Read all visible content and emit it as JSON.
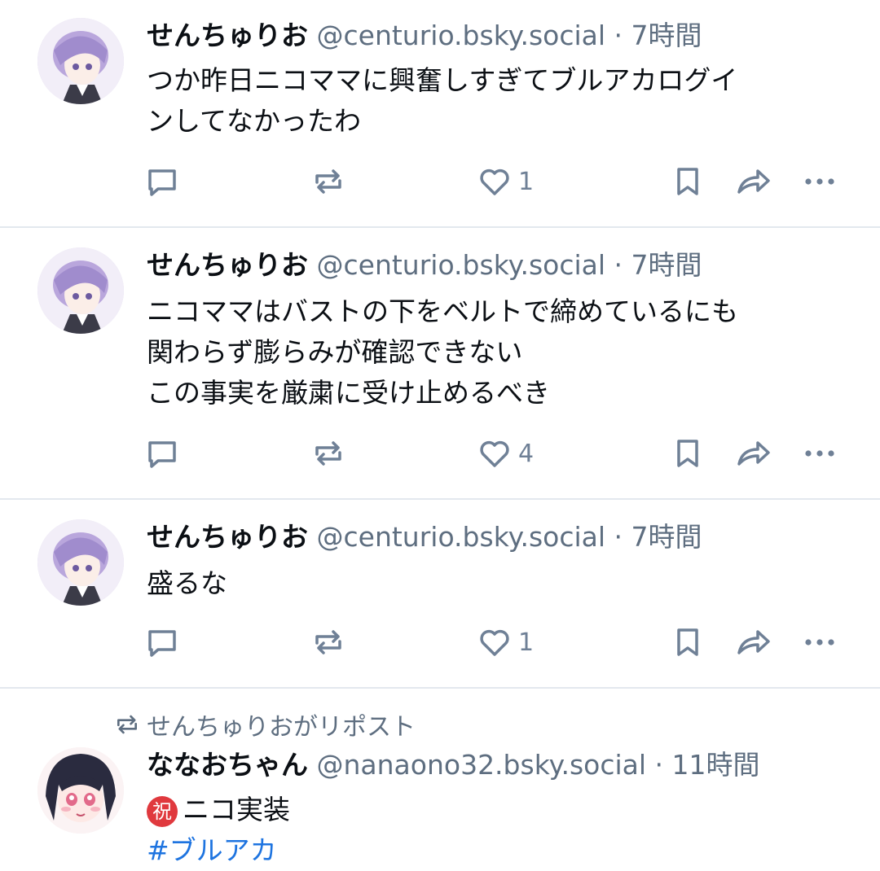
{
  "posts": [
    {
      "display_name": "せんちゅりお",
      "handle": "@centurio.bsky.social",
      "separator": "·",
      "time": "7時間",
      "lines": [
        "つか昨日ニコママに興奮しすぎてブルアカログイ",
        "ンしてなかったわ"
      ],
      "like_count": "1"
    },
    {
      "display_name": "せんちゅりお",
      "handle": "@centurio.bsky.social",
      "separator": "·",
      "time": "7時間",
      "lines": [
        "ニコママはバストの下をベルトで締めているにも",
        "関わらず膨らみが確認できない",
        "この事実を厳粛に受け止めるべき"
      ],
      "like_count": "4"
    },
    {
      "display_name": "せんちゅりお",
      "handle": "@centurio.bsky.social",
      "separator": "·",
      "time": "7時間",
      "lines": [
        "盛るな"
      ],
      "like_count": "1"
    }
  ],
  "repost": {
    "label": "せんちゅりおがリポスト",
    "display_name": "ななおちゃん",
    "handle": "@nanaono32.bsky.social",
    "separator": "·",
    "time": "11時間",
    "badge": "祝",
    "line1": "ニコ実装",
    "hashtag": "#ブルアカ"
  },
  "icons": [
    "reply-icon",
    "repost-icon",
    "like-icon",
    "bookmark-icon",
    "share-icon",
    "more-icon"
  ],
  "colors": {
    "text": "#0b0f14",
    "muted": "#5e6e80",
    "icon": "#6f8096",
    "divider": "#e3e8ee",
    "link": "#1e74e0",
    "badge": "#e0393e"
  }
}
